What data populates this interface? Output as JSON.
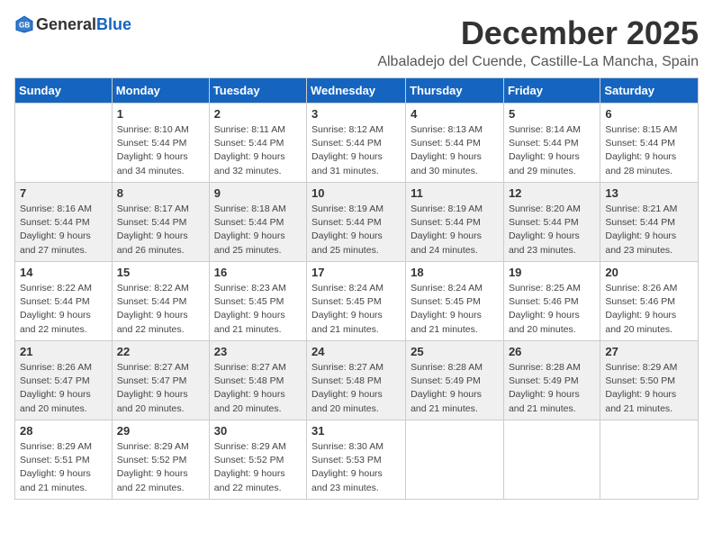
{
  "logo": {
    "general": "General",
    "blue": "Blue"
  },
  "title": "December 2025",
  "subtitle": "Albaladejo del Cuende, Castille-La Mancha, Spain",
  "days_of_week": [
    "Sunday",
    "Monday",
    "Tuesday",
    "Wednesday",
    "Thursday",
    "Friday",
    "Saturday"
  ],
  "weeks": [
    [
      {
        "day": "",
        "info": ""
      },
      {
        "day": "1",
        "info": "Sunrise: 8:10 AM\nSunset: 5:44 PM\nDaylight: 9 hours\nand 34 minutes."
      },
      {
        "day": "2",
        "info": "Sunrise: 8:11 AM\nSunset: 5:44 PM\nDaylight: 9 hours\nand 32 minutes."
      },
      {
        "day": "3",
        "info": "Sunrise: 8:12 AM\nSunset: 5:44 PM\nDaylight: 9 hours\nand 31 minutes."
      },
      {
        "day": "4",
        "info": "Sunrise: 8:13 AM\nSunset: 5:44 PM\nDaylight: 9 hours\nand 30 minutes."
      },
      {
        "day": "5",
        "info": "Sunrise: 8:14 AM\nSunset: 5:44 PM\nDaylight: 9 hours\nand 29 minutes."
      },
      {
        "day": "6",
        "info": "Sunrise: 8:15 AM\nSunset: 5:44 PM\nDaylight: 9 hours\nand 28 minutes."
      }
    ],
    [
      {
        "day": "7",
        "info": "Sunrise: 8:16 AM\nSunset: 5:44 PM\nDaylight: 9 hours\nand 27 minutes."
      },
      {
        "day": "8",
        "info": "Sunrise: 8:17 AM\nSunset: 5:44 PM\nDaylight: 9 hours\nand 26 minutes."
      },
      {
        "day": "9",
        "info": "Sunrise: 8:18 AM\nSunset: 5:44 PM\nDaylight: 9 hours\nand 25 minutes."
      },
      {
        "day": "10",
        "info": "Sunrise: 8:19 AM\nSunset: 5:44 PM\nDaylight: 9 hours\nand 25 minutes."
      },
      {
        "day": "11",
        "info": "Sunrise: 8:19 AM\nSunset: 5:44 PM\nDaylight: 9 hours\nand 24 minutes."
      },
      {
        "day": "12",
        "info": "Sunrise: 8:20 AM\nSunset: 5:44 PM\nDaylight: 9 hours\nand 23 minutes."
      },
      {
        "day": "13",
        "info": "Sunrise: 8:21 AM\nSunset: 5:44 PM\nDaylight: 9 hours\nand 23 minutes."
      }
    ],
    [
      {
        "day": "14",
        "info": "Sunrise: 8:22 AM\nSunset: 5:44 PM\nDaylight: 9 hours\nand 22 minutes."
      },
      {
        "day": "15",
        "info": "Sunrise: 8:22 AM\nSunset: 5:44 PM\nDaylight: 9 hours\nand 22 minutes."
      },
      {
        "day": "16",
        "info": "Sunrise: 8:23 AM\nSunset: 5:45 PM\nDaylight: 9 hours\nand 21 minutes."
      },
      {
        "day": "17",
        "info": "Sunrise: 8:24 AM\nSunset: 5:45 PM\nDaylight: 9 hours\nand 21 minutes."
      },
      {
        "day": "18",
        "info": "Sunrise: 8:24 AM\nSunset: 5:45 PM\nDaylight: 9 hours\nand 21 minutes."
      },
      {
        "day": "19",
        "info": "Sunrise: 8:25 AM\nSunset: 5:46 PM\nDaylight: 9 hours\nand 20 minutes."
      },
      {
        "day": "20",
        "info": "Sunrise: 8:26 AM\nSunset: 5:46 PM\nDaylight: 9 hours\nand 20 minutes."
      }
    ],
    [
      {
        "day": "21",
        "info": "Sunrise: 8:26 AM\nSunset: 5:47 PM\nDaylight: 9 hours\nand 20 minutes."
      },
      {
        "day": "22",
        "info": "Sunrise: 8:27 AM\nSunset: 5:47 PM\nDaylight: 9 hours\nand 20 minutes."
      },
      {
        "day": "23",
        "info": "Sunrise: 8:27 AM\nSunset: 5:48 PM\nDaylight: 9 hours\nand 20 minutes."
      },
      {
        "day": "24",
        "info": "Sunrise: 8:27 AM\nSunset: 5:48 PM\nDaylight: 9 hours\nand 20 minutes."
      },
      {
        "day": "25",
        "info": "Sunrise: 8:28 AM\nSunset: 5:49 PM\nDaylight: 9 hours\nand 21 minutes."
      },
      {
        "day": "26",
        "info": "Sunrise: 8:28 AM\nSunset: 5:49 PM\nDaylight: 9 hours\nand 21 minutes."
      },
      {
        "day": "27",
        "info": "Sunrise: 8:29 AM\nSunset: 5:50 PM\nDaylight: 9 hours\nand 21 minutes."
      }
    ],
    [
      {
        "day": "28",
        "info": "Sunrise: 8:29 AM\nSunset: 5:51 PM\nDaylight: 9 hours\nand 21 minutes."
      },
      {
        "day": "29",
        "info": "Sunrise: 8:29 AM\nSunset: 5:52 PM\nDaylight: 9 hours\nand 22 minutes."
      },
      {
        "day": "30",
        "info": "Sunrise: 8:29 AM\nSunset: 5:52 PM\nDaylight: 9 hours\nand 22 minutes."
      },
      {
        "day": "31",
        "info": "Sunrise: 8:30 AM\nSunset: 5:53 PM\nDaylight: 9 hours\nand 23 minutes."
      },
      {
        "day": "",
        "info": ""
      },
      {
        "day": "",
        "info": ""
      },
      {
        "day": "",
        "info": ""
      }
    ]
  ]
}
